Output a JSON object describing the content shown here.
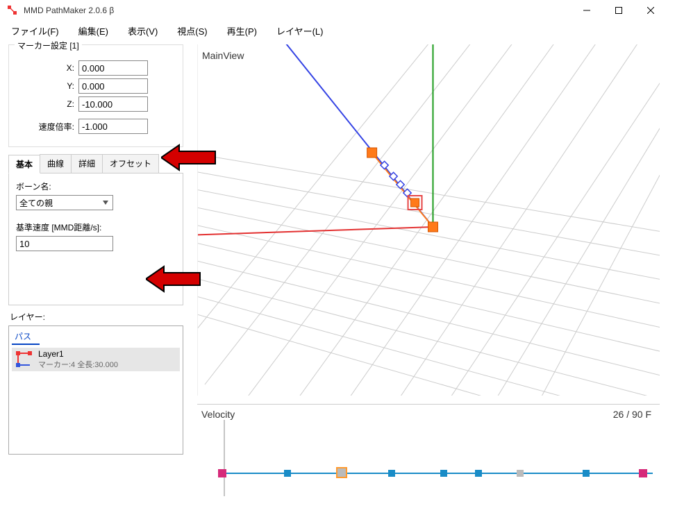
{
  "window": {
    "title": "MMD PathMaker 2.0.6 β"
  },
  "menu": {
    "file": "ファイル(F)",
    "edit": "編集(E)",
    "view": "表示(V)",
    "viewpoint": "視点(S)",
    "play": "再生(P)",
    "layer": "レイヤー(L)"
  },
  "marker": {
    "group_title": "マーカー設定 [1]",
    "x_label": "X:",
    "x_value": "0.000",
    "y_label": "Y:",
    "y_value": "0.000",
    "z_label": "Z:",
    "z_value": "-10.000",
    "speedmul_label": "速度倍率:",
    "speedmul_value": "-1.000"
  },
  "tabs": {
    "basic": "基本",
    "curve": "曲線",
    "detail": "詳細",
    "offset": "オフセット"
  },
  "basic_tab": {
    "bone_label": "ボーン名:",
    "bone_value": "全ての親",
    "basespeed_label": "基準速度 [MMD距離/s]:",
    "basespeed_value": "10"
  },
  "layers": {
    "label": "レイヤー:",
    "header": "パス",
    "items": [
      {
        "name": "Layer1",
        "sub": "マーカー:4 全長:30.000"
      }
    ]
  },
  "mainview": {
    "label": "MainView"
  },
  "velocity": {
    "label": "Velocity",
    "frame_status": "26 / 90 F"
  }
}
